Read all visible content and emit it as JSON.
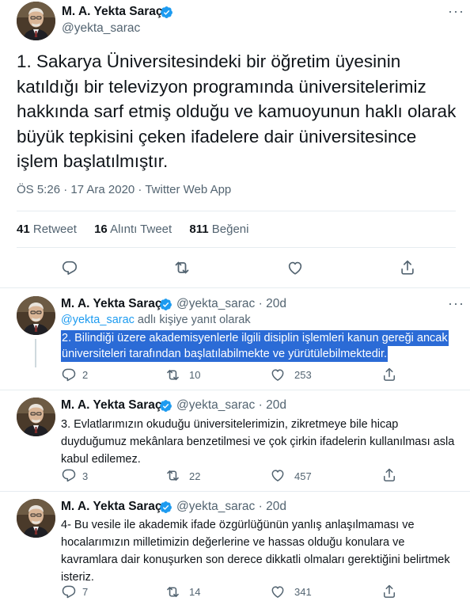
{
  "colors": {
    "accent": "#1d9bf0",
    "text": "#0f1419",
    "muted": "#536471",
    "highlight": "#2b6bd6"
  },
  "main": {
    "name": "M. A. Yekta Saraç",
    "handle": "@yekta_sarac",
    "text": "1. Sakarya Üniversitesindeki bir öğretim üyesinin katıldığı bir televizyon programında üniversitelerimiz hakkında sarf etmiş olduğu ve kamuoyunun haklı olarak büyük tepkisini çeken ifadelere dair üniversitesince işlem başlatılmıştır.",
    "timestamp": "ÖS 5:26 · 17 Ara 2020 · Twitter Web App",
    "stats": {
      "retweets_count": "41",
      "retweets_label": "Retweet",
      "quotes_count": "16",
      "quotes_label": "Alıntı Tweet",
      "likes_count": "811",
      "likes_label": "Beğeni"
    },
    "more": "···"
  },
  "replies": [
    {
      "name": "M. A. Yekta Saraç",
      "handle": "@yekta_sarac · 20d",
      "replying_link": "@yekta_sarac",
      "replying_suffix": " adlı kişiye yanıt olarak",
      "line1": "2. Bilindiği üzere akademisyenlerle ilgili disiplin işlemleri kanun gereği ancak",
      "line2": "üniversiteleri tarafından başlatılabilmekte ve yürütülebilmektedir.",
      "reply_count": "2",
      "retweet_count": "10",
      "like_count": "253"
    },
    {
      "name": "M. A. Yekta Saraç",
      "handle": "@yekta_sarac · 20d",
      "text": "3. Evlatlarımızın okuduğu üniversitelerimizin, zikretmeye bile hicap duyduğumuz mekânlara benzetilmesi ve çok çirkin ifadelerin kullanılması asla kabul edilemez.",
      "reply_count": "3",
      "retweet_count": "22",
      "like_count": "457"
    },
    {
      "name": "M. A. Yekta Saraç",
      "handle": "@yekta_sarac · 20d",
      "text": "4- Bu vesile ile akademik ifade özgürlüğünün yanlış anlaşılmaması ve hocalarımızın milletimizin değerlerine ve hassas olduğu konulara ve kavramlara dair konuşurken son derece dikkatli olmaları gerektiğini belirtmek isteriz.",
      "reply_count": "7",
      "retweet_count": "14",
      "like_count": "341"
    }
  ],
  "icons": [
    "verified-icon",
    "reply-icon",
    "retweet-icon",
    "like-icon",
    "share-icon",
    "more-icon"
  ]
}
